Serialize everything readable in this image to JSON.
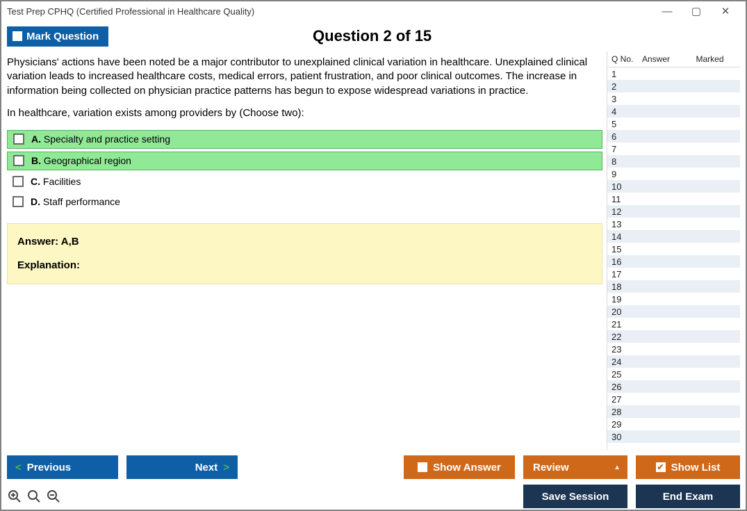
{
  "window": {
    "title": "Test Prep CPHQ (Certified Professional in Healthcare Quality)"
  },
  "header": {
    "mark_label": "Mark Question",
    "question_title": "Question 2 of 15"
  },
  "question": {
    "prompt_p1": "Physicians' actions have been noted be a major contributor to unexplained clinical variation in healthcare. Unexplained clinical variation leads to increased healthcare costs, medical errors, patient frustration, and poor clinical outcomes. The increase in information being collected on physician practice patterns has begun to expose widespread variations in practice.",
    "prompt_p2": "In healthcare, variation exists among providers by (Choose two):",
    "options": [
      {
        "letter": "A.",
        "text": "Specialty and practice setting",
        "correct": true
      },
      {
        "letter": "B.",
        "text": "Geographical region",
        "correct": true
      },
      {
        "letter": "C.",
        "text": "Facilities",
        "correct": false
      },
      {
        "letter": "D.",
        "text": "Staff performance",
        "correct": false
      }
    ],
    "answer_line": "Answer: A,B",
    "explanation_label": "Explanation:"
  },
  "list": {
    "headers": {
      "qno": "Q No.",
      "answer": "Answer",
      "marked": "Marked"
    },
    "current": 2,
    "rows": [
      1,
      2,
      3,
      4,
      5,
      6,
      7,
      8,
      9,
      10,
      11,
      12,
      13,
      14,
      15,
      16,
      17,
      18,
      19,
      20,
      21,
      22,
      23,
      24,
      25,
      26,
      27,
      28,
      29,
      30
    ]
  },
  "footer": {
    "previous": "Previous",
    "next": "Next",
    "show_answer": "Show Answer",
    "review": "Review",
    "show_list": "Show List",
    "save_session": "Save Session",
    "end_exam": "End Exam"
  }
}
